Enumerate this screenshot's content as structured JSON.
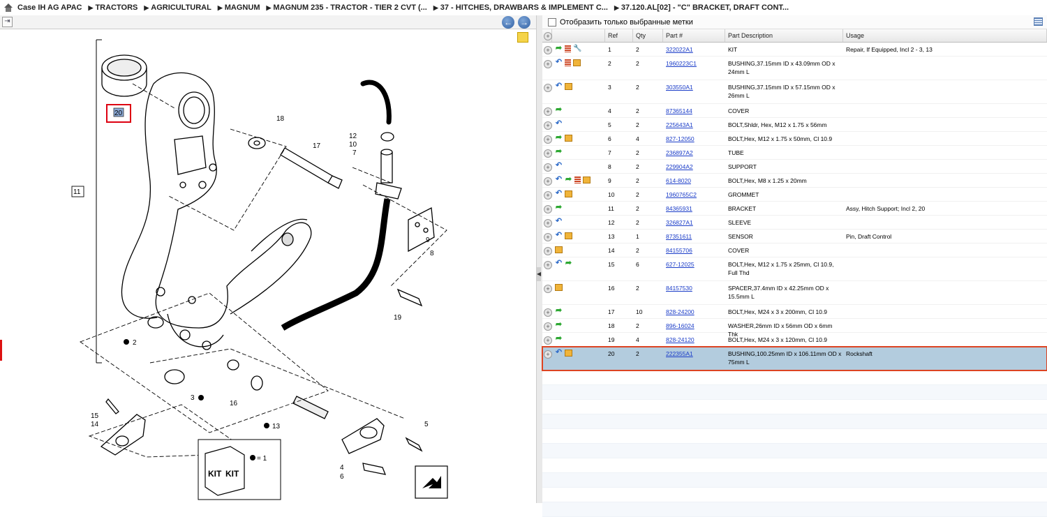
{
  "breadcrumb": [
    "Case IH AG APAC",
    "TRACTORS",
    "AGRICULTURAL",
    "MAGNUM",
    "MAGNUM 235 - TRACTOR - TIER 2 CVT (...",
    "37 - HITCHES, DRAWBARS & IMPLEMENT C...",
    "37.120.AL[02] - \"C\" BRACKET, DRAFT CONT..."
  ],
  "filter": {
    "label": "Отобразить только выбранные метки"
  },
  "columns": {
    "ref": "Ref",
    "qty": "Qty",
    "part": "Part #",
    "desc": "Part Description",
    "usage": "Usage"
  },
  "icon_names": [
    "green-arrow-icon",
    "blue-return-icon",
    "red-list-icon",
    "wrench-icon",
    "box-icon"
  ],
  "rows": [
    {
      "ref": "1",
      "qty": "2",
      "part": "322022A1",
      "desc": "KIT",
      "usage": "Repair, If Equipped, Incl 2 - 3, 13",
      "icons": [
        "green",
        "red",
        "wrench"
      ]
    },
    {
      "ref": "2",
      "qty": "2",
      "part": "1960223C1",
      "desc": "BUSHING,37.15mm ID x 43.09mm OD x 24mm L",
      "usage": "",
      "icons": [
        "blue",
        "red",
        "box"
      ]
    },
    {
      "ref": "3",
      "qty": "2",
      "part": "303550A1",
      "desc": "BUSHING,37.15mm ID x 57.15mm OD x 26mm L",
      "usage": "",
      "icons": [
        "blue",
        "box"
      ]
    },
    {
      "ref": "4",
      "qty": "2",
      "part": "87365144",
      "desc": "COVER",
      "usage": "",
      "icons": [
        "green"
      ]
    },
    {
      "ref": "5",
      "qty": "2",
      "part": "225643A1",
      "desc": "BOLT,Shldr, Hex, M12 x 1.75 x 56mm",
      "usage": "",
      "icons": [
        "blue"
      ]
    },
    {
      "ref": "6",
      "qty": "4",
      "part": "827-12050",
      "desc": "BOLT,Hex, M12 x 1.75 x 50mm, Cl 10.9",
      "usage": "",
      "icons": [
        "green",
        "box"
      ]
    },
    {
      "ref": "7",
      "qty": "2",
      "part": "236897A2",
      "desc": "TUBE",
      "usage": "",
      "icons": [
        "green"
      ]
    },
    {
      "ref": "8",
      "qty": "2",
      "part": "229904A2",
      "desc": "SUPPORT",
      "usage": "",
      "icons": [
        "blue"
      ]
    },
    {
      "ref": "9",
      "qty": "2",
      "part": "614-8020",
      "desc": "BOLT,Hex, M8 x 1.25 x 20mm",
      "usage": "",
      "icons": [
        "blue",
        "green",
        "red",
        "box"
      ]
    },
    {
      "ref": "10",
      "qty": "2",
      "part": "1960765C2",
      "desc": "GROMMET",
      "usage": "",
      "icons": [
        "blue",
        "box"
      ]
    },
    {
      "ref": "11",
      "qty": "2",
      "part": "84365931",
      "desc": "BRACKET",
      "usage": "Assy, Hitch Support; Incl 2, 20",
      "icons": [
        "green"
      ]
    },
    {
      "ref": "12",
      "qty": "2",
      "part": "326827A1",
      "desc": "SLEEVE",
      "usage": "",
      "icons": [
        "blue"
      ]
    },
    {
      "ref": "13",
      "qty": "1",
      "part": "87351611",
      "desc": "SENSOR",
      "usage": "Pin, Draft Control",
      "icons": [
        "blue",
        "box"
      ]
    },
    {
      "ref": "14",
      "qty": "2",
      "part": "84155706",
      "desc": "COVER",
      "usage": "",
      "icons": [
        "box"
      ]
    },
    {
      "ref": "15",
      "qty": "6",
      "part": "627-12025",
      "desc": "BOLT,Hex, M12 x 1.75 x 25mm, Cl 10.9, Full Thd",
      "usage": "",
      "icons": [
        "blue",
        "green"
      ]
    },
    {
      "ref": "16",
      "qty": "2",
      "part": "84157530",
      "desc": "SPACER,37.4mm ID x 42.25mm OD x 15.5mm L",
      "usage": "",
      "icons": [
        "box"
      ]
    },
    {
      "ref": "17",
      "qty": "10",
      "part": "828-24200",
      "desc": "BOLT,Hex, M24 x 3 x 200mm, Cl 10.9",
      "usage": "",
      "icons": [
        "green"
      ]
    },
    {
      "ref": "18",
      "qty": "2",
      "part": "896-16024",
      "desc": "WASHER,26mm ID x 56mm OD x 6mm Thk",
      "usage": "",
      "icons": [
        "green"
      ]
    },
    {
      "ref": "19",
      "qty": "4",
      "part": "828-24120",
      "desc": "BOLT,Hex, M24 x 3 x 120mm, Cl 10.9",
      "usage": "",
      "icons": [
        "green"
      ]
    },
    {
      "ref": "20",
      "qty": "2",
      "part": "222355A1",
      "desc": "BUSHING,100.25mm ID x 106.11mm OD x 75mm L",
      "usage": "Rockshaft",
      "icons": [
        "blue",
        "box"
      ],
      "selected": true
    }
  ],
  "diagram": {
    "callouts": [
      "20",
      "18",
      "17",
      "12",
      "10",
      "7",
      "11",
      "9",
      "8",
      "2",
      "19",
      "3",
      "16",
      "13",
      "5",
      "4",
      "6",
      "15",
      "14"
    ],
    "kit_label": "KIT",
    "kit_legend": "= 1"
  }
}
